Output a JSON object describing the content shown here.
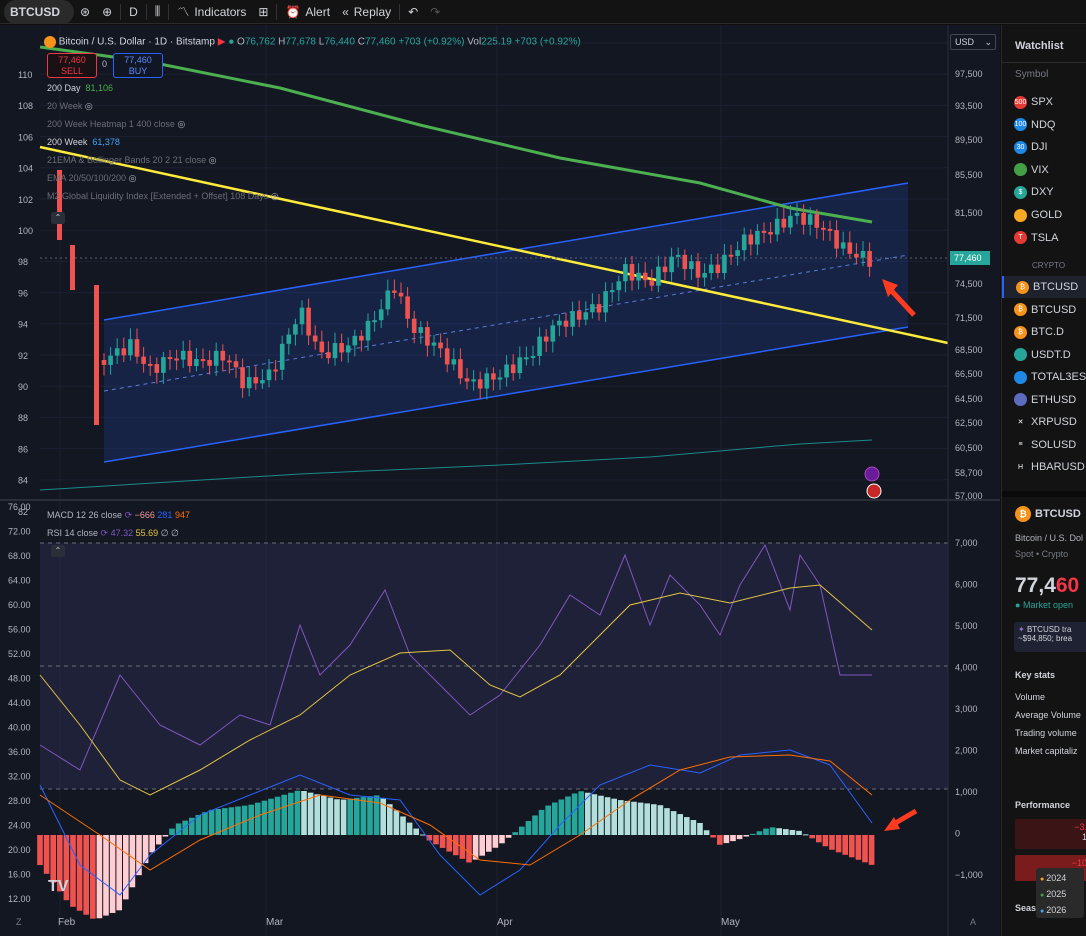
{
  "toolbar": {
    "symbol": "BTCUSD",
    "interval": "D",
    "indicators": "Indicators",
    "alert": "Alert",
    "replay": "Replay"
  },
  "legend": {
    "title": "Bitcoin / U.S. Dollar · 1D · Bitstamp",
    "o": "76,762",
    "h": "77,678",
    "l": "76,440",
    "c": "77,460",
    "change": "+703 (+0.92%)",
    "vol_label": "Vol",
    "vol": "225.19",
    "vol_change": "+703 (+0.92%)"
  },
  "order": {
    "sell_price": "77,460",
    "sell_label": "SELL",
    "spread": "0",
    "buy_price": "77,460",
    "buy_label": "BUY"
  },
  "indicators": [
    {
      "name": "200 Day",
      "value": "81,106",
      "color": "#4caf50"
    },
    {
      "name": "20 Week",
      "value": "",
      "color": ""
    },
    {
      "name": "200 Week Heatmap 1 400 close",
      "value": "",
      "color": ""
    },
    {
      "name": "200 Week",
      "value": "61,378",
      "color": "#42a5f5"
    },
    {
      "name": "21EMA & Bollinger Bands 20 2 21 close",
      "value": "",
      "color": ""
    },
    {
      "name": "EMA 20/50/100/200",
      "value": "",
      "color": ""
    },
    {
      "name": "M2 Global Liquidity Index [Extended + Offset] 108 Days",
      "value": "",
      "color": ""
    }
  ],
  "currency": "USD",
  "price_scale": [
    "97,500",
    "93,500",
    "89,500",
    "85,500",
    "81,500",
    "77,460",
    "74,500",
    "71,500",
    "68,500",
    "66,500",
    "64,500",
    "62,500",
    "60,500",
    "58,700",
    "57,000"
  ],
  "current_price": "77,460",
  "left_scale_top": [
    "110",
    "108",
    "106",
    "104",
    "102",
    "100",
    "98",
    "96",
    "94",
    "92",
    "90",
    "88",
    "86",
    "84",
    "82"
  ],
  "left_scale_bottom": [
    "76.00",
    "72.00",
    "68.00",
    "64.00",
    "60.00",
    "56.00",
    "52.00",
    "48.00",
    "44.00",
    "40.00",
    "36.00",
    "32.00",
    "28.00",
    "24.00",
    "20.00",
    "16.00",
    "12.00"
  ],
  "macd_scale": [
    "7,000",
    "6,000",
    "5,000",
    "4,000",
    "3,000",
    "2,000",
    "1,000",
    "0",
    "−1,000"
  ],
  "macd": {
    "label": "MACD 12 26 close",
    "v1": "−666",
    "v2": "281",
    "v3": "947"
  },
  "rsi": {
    "label": "RSI 14 close",
    "v1": "47.32",
    "v2": "55.69",
    "v3": "∅ ∅"
  },
  "months": [
    "Feb",
    "Mar",
    "Apr",
    "May"
  ],
  "watchlist": {
    "title": "Watchlist",
    "col": "Symbol",
    "crypto_label": "CRYPTO",
    "items": [
      {
        "sym": "SPX",
        "icon": "500",
        "color": "#e53935"
      },
      {
        "sym": "NDQ",
        "icon": "100",
        "color": "#1e88e5"
      },
      {
        "sym": "DJI",
        "icon": "30",
        "color": "#1e88e5"
      },
      {
        "sym": "VIX",
        "icon": "",
        "color": "#43a047"
      },
      {
        "sym": "DXY",
        "icon": "$",
        "color": "#26a69a"
      },
      {
        "sym": "GOLD",
        "icon": "",
        "color": "#f9a825"
      },
      {
        "sym": "TSLA",
        "icon": "T",
        "color": "#e53935"
      },
      {
        "sym": "BTCUSD",
        "icon": "₿",
        "color": "#f7931a"
      },
      {
        "sym": "BTCUSD",
        "icon": "₿",
        "color": "#f7931a"
      },
      {
        "sym": "BTC.D",
        "icon": "₿",
        "color": "#f7931a"
      },
      {
        "sym": "USDT.D",
        "icon": "",
        "color": "#26a69a"
      },
      {
        "sym": "TOTAL3ES",
        "icon": "",
        "color": "#1e88e5"
      },
      {
        "sym": "ETHUSD",
        "icon": "",
        "color": "#5c6bc0"
      },
      {
        "sym": "XRPUSD",
        "icon": "✕",
        "color": "#131313"
      },
      {
        "sym": "SOLUSD",
        "icon": "≡",
        "color": "#131313"
      },
      {
        "sym": "HBARUSD",
        "icon": "H",
        "color": "#131313"
      }
    ]
  },
  "details": {
    "symbol": "BTCUSD",
    "name": "Bitcoin / U.S. Dol",
    "type": "Spot • Crypto",
    "price_a": "77,4",
    "price_b": "60",
    "status": "Market open",
    "news": "BTCUSD tra",
    "news2": "~$94,850; brea",
    "key_stats": "Key stats",
    "stats": [
      "Volume",
      "Average Volume",
      "Trading volume",
      "Market capitaliz"
    ],
    "performance": "Performance",
    "perf1": "−3.",
    "perf1b": "1",
    "perf2": "−10",
    "seasonals": "Seas",
    "years": [
      {
        "y": "2024",
        "c": "#f9a825"
      },
      {
        "y": "2025",
        "c": "#43a047"
      },
      {
        "y": "2026",
        "c": "#42a5f5"
      }
    ]
  },
  "colors": {
    "up": "#26a69a",
    "down": "#ef5350",
    "ma200": "#4caf50",
    "trend": "#ffeb3b",
    "channel": "#2962ff",
    "rsi": "#7e57c2",
    "rsi_ma": "#e1c542",
    "macd": "#2962ff",
    "signal": "#ff6d00"
  }
}
